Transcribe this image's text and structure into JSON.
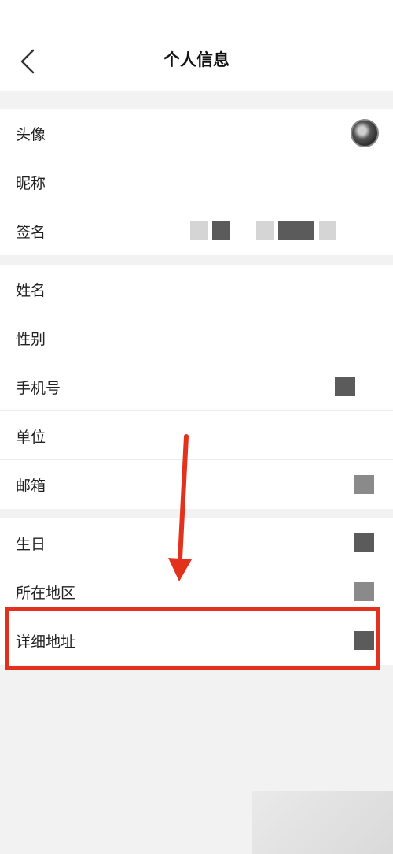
{
  "header": {
    "title": "个人信息",
    "back_icon": "chevron-left-icon"
  },
  "groups": [
    {
      "rows": [
        {
          "label": "头像"
        },
        {
          "label": "昵称"
        },
        {
          "label": "签名"
        }
      ]
    },
    {
      "rows": [
        {
          "label": "姓名"
        },
        {
          "label": "性别"
        },
        {
          "label": "手机号"
        },
        {
          "label": "单位"
        },
        {
          "label": "邮箱"
        }
      ]
    },
    {
      "rows": [
        {
          "label": "生日"
        },
        {
          "label": "所在地区"
        },
        {
          "label": "详细地址"
        }
      ]
    }
  ],
  "annotation": {
    "highlight_color": "#e2321e",
    "highlighted_row": "详细地址"
  }
}
